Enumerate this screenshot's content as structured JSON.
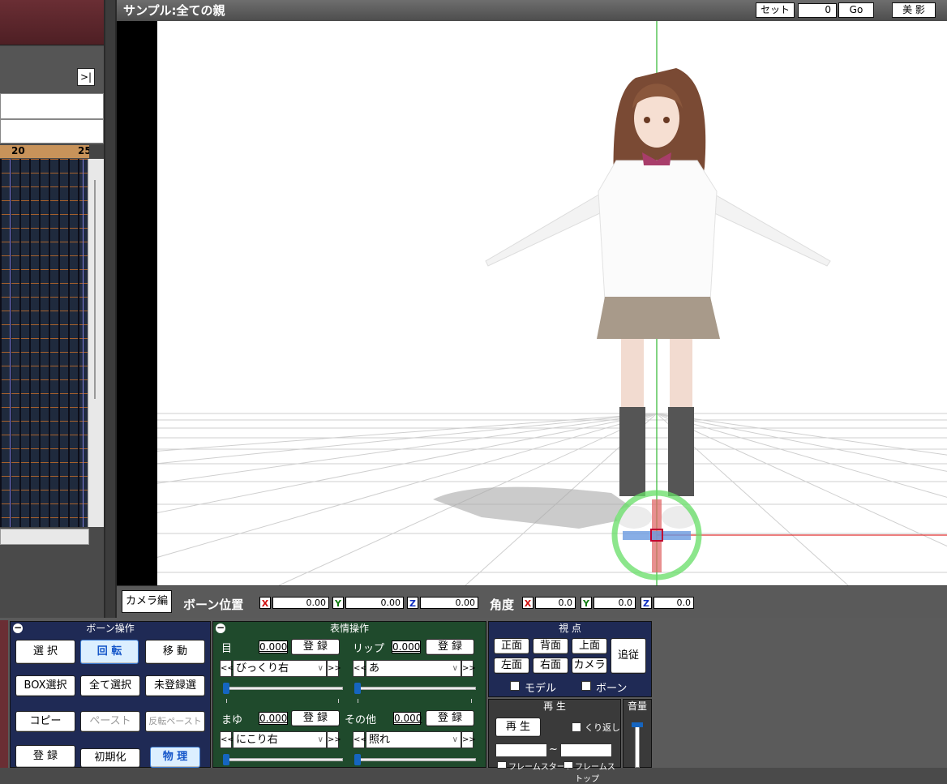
{
  "viewport": {
    "title": "サンプル:全ての親",
    "set_label": "セット",
    "frame_value": "0",
    "go_label": "Go",
    "bieye_label": "美 影"
  },
  "timeline": {
    "expand_label": ">|",
    "ruler_labels": [
      "20",
      "25"
    ]
  },
  "bone_bar": {
    "camera_edit": "カメラ編",
    "position_label": "ボーン位置",
    "angle_label": "角度",
    "axes": [
      "X",
      "Y",
      "Z"
    ],
    "position": [
      "0.00",
      "0.00",
      "0.00"
    ],
    "angle": [
      "0.0",
      "0.0",
      "0.0"
    ],
    "axis_colors": {
      "X": "#d01010",
      "Y": "#107a10",
      "Z": "#1030c0"
    }
  },
  "bone_ops": {
    "title": "ボーン操作",
    "select": "選 択",
    "rotate": "回 転",
    "move": "移 動",
    "box_select": "BOX選択",
    "select_all": "全て選択",
    "unregistered": "未登録選",
    "copy": "コピー",
    "paste": "ペースト",
    "flip_paste": "反転ペースト",
    "register": "登 録",
    "initialize": "初期化",
    "physics": "物 理"
  },
  "morph": {
    "title": "表情操作",
    "eye": {
      "label": "目",
      "value": "0.000",
      "selected": "びっくり右"
    },
    "lip": {
      "label": "リップ",
      "value": "0.000",
      "selected": "あ"
    },
    "brow": {
      "label": "まゆ",
      "value": "0.000",
      "selected": "にこり右"
    },
    "other": {
      "label": "その他",
      "value": "0.000",
      "selected": "照れ"
    },
    "register": "登 録",
    "prev": "<<",
    "next": ">>"
  },
  "view": {
    "title": "視 点",
    "front": "正面",
    "back": "背面",
    "top": "上面",
    "left": "左面",
    "right": "右面",
    "camera": "カメラ",
    "follow": "追従",
    "model_cb": "モデル",
    "bone_cb": "ボーン"
  },
  "playback": {
    "title": "再 生",
    "play": "再 生",
    "loop": "くり返し",
    "tilde": "~",
    "frame_start": "フレームスタート",
    "frame_stop": "フレームストップ",
    "volume": "音量"
  },
  "colors": {
    "bone_panel": "#1f2a55",
    "morph_panel": "#1f4a2c",
    "view_panel": "#1f2a55",
    "playback_panel": "#3a3a3a",
    "timeline_header": "#6a2e34"
  }
}
